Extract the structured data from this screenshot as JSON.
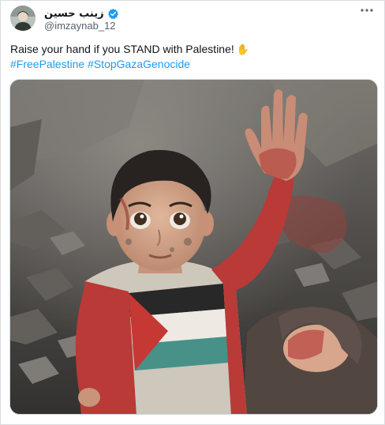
{
  "author": {
    "display_name": "زينب حسين",
    "handle": "@imzaynab_12",
    "verified": true,
    "avatar_icon": "user-avatar"
  },
  "tweet": {
    "text": "Raise your hand if you STAND with Palestine!",
    "emoji": "✋",
    "hashtags": [
      "#FreePalestine",
      "#StopGazaGenocide"
    ]
  },
  "icons": {
    "verified_icon": "verified-badge-icon",
    "more_icon": "more-options-icon"
  },
  "colors": {
    "accent": "#1d9bf0",
    "text": "#0f1419",
    "secondary": "#536471",
    "verified": "#1d9bf0"
  }
}
